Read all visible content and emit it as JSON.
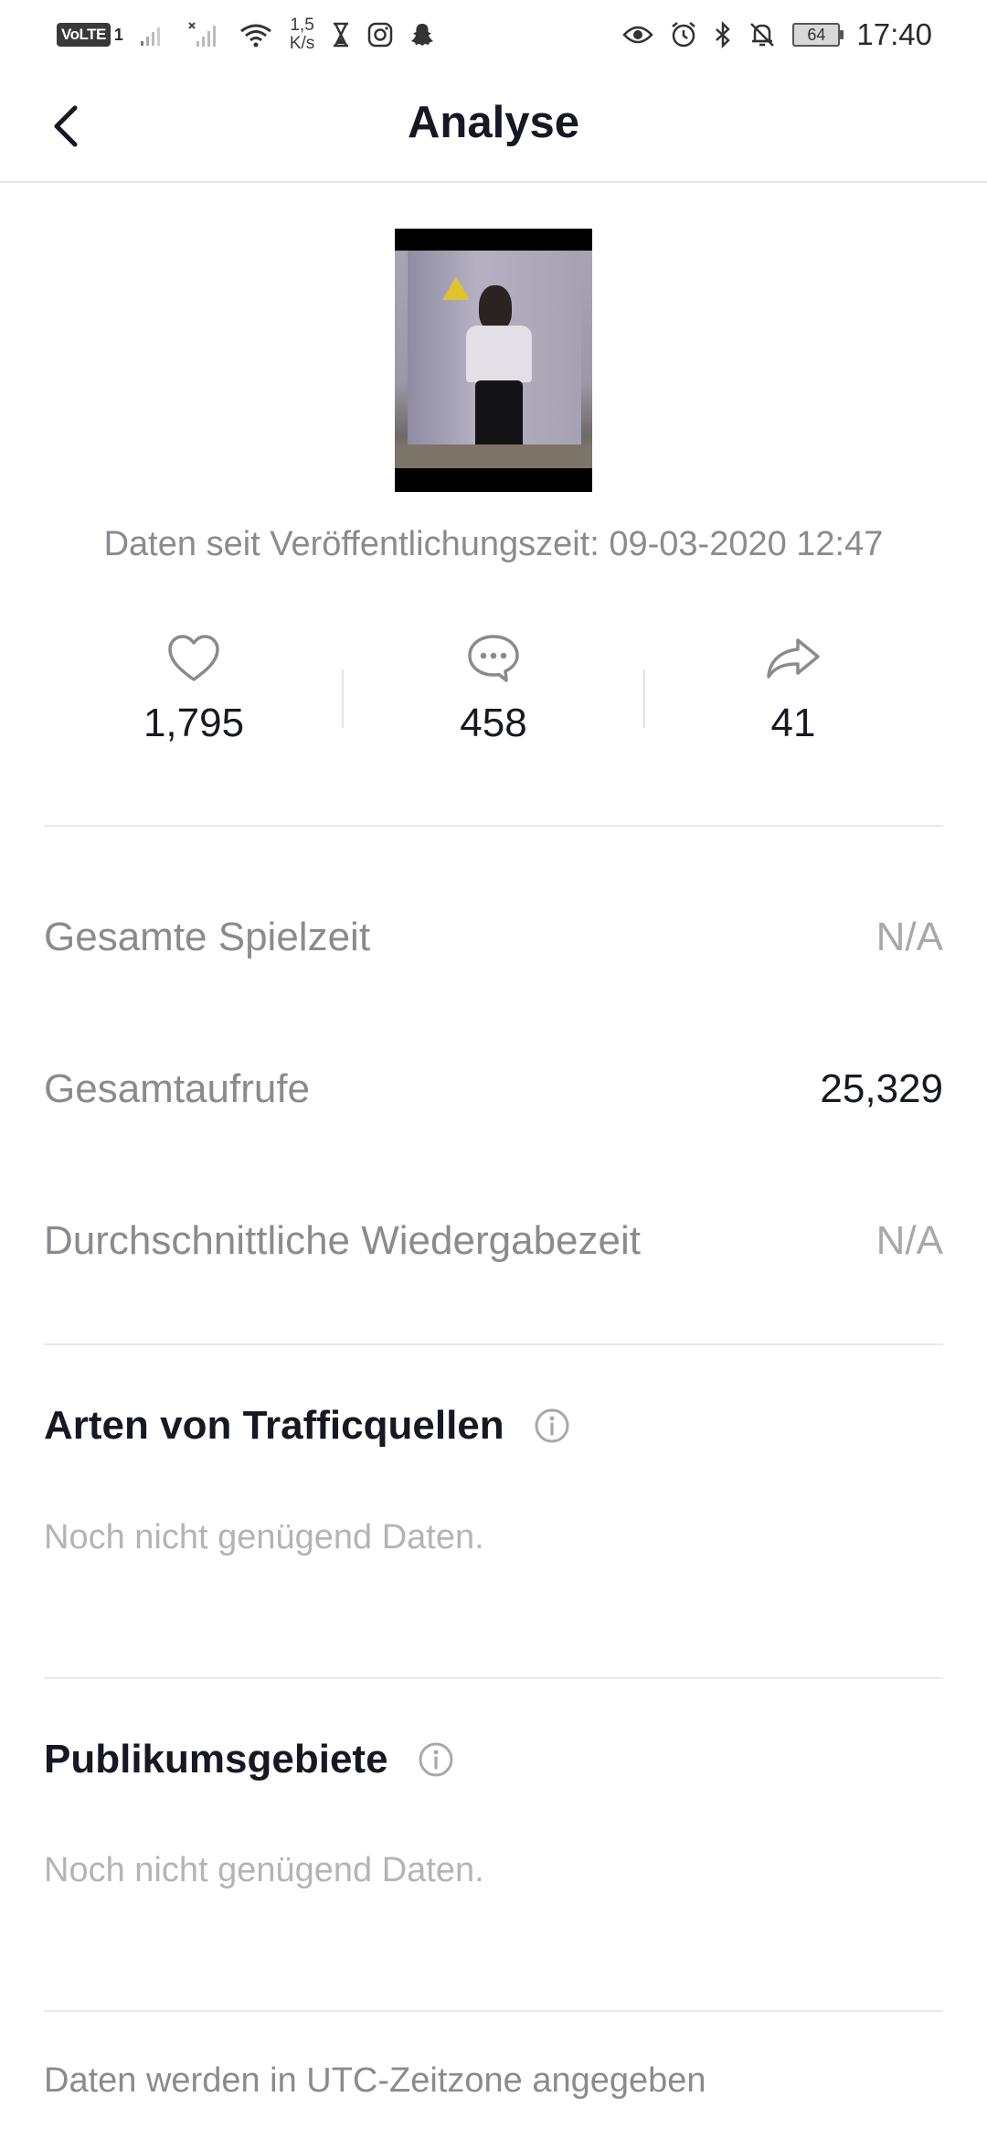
{
  "status_bar": {
    "volte": "VoLTE",
    "volte_sim": "1",
    "net_speed_value": "1,5",
    "net_speed_unit": "K/s",
    "battery": "64",
    "time": "17:40"
  },
  "header": {
    "title": "Analyse",
    "back_icon": "chevron-left-icon"
  },
  "post": {
    "published_text": "Daten seit Veröffentlichungszeit: 09-03-2020 12:47"
  },
  "stats": {
    "likes": "1,795",
    "comments": "458",
    "shares": "41",
    "icons": [
      "heart-icon",
      "comment-icon",
      "share-icon"
    ]
  },
  "metrics": [
    {
      "label": "Gesamte Spielzeit",
      "value": "N/A"
    },
    {
      "label": "Gesamtaufrufe",
      "value": "25,329"
    },
    {
      "label": "Durchschnittliche Wiedergabezeit",
      "value": "N/A"
    }
  ],
  "sections": {
    "traffic": {
      "title": "Arten von Trafficquellen",
      "note": "Noch nicht genügend Daten."
    },
    "audience": {
      "title": "Publikumsgebiete",
      "note": "Noch nicht genügend Daten."
    }
  },
  "footer": {
    "note": "Daten werden in UTC-Zeitzone angegeben"
  },
  "colors": {
    "text_primary": "#161823",
    "text_secondary": "#8a8b91",
    "text_muted": "#b3b4b8",
    "divider": "#e8e8e9"
  }
}
